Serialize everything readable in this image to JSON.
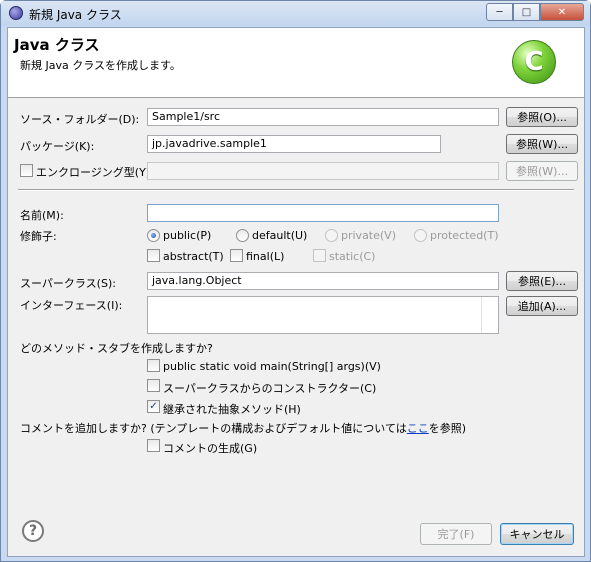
{
  "window": {
    "title": "新規 Java クラス",
    "minimize": "─",
    "maximize": "□",
    "close": "✕"
  },
  "banner": {
    "title": "Java クラス",
    "subtitle": "新規 Java クラスを作成します。",
    "icon_letter": "C"
  },
  "form": {
    "source_folder": {
      "label": "ソース・フォルダー(D):",
      "value": "Sample1/src",
      "button": "参照(O)..."
    },
    "package": {
      "label": "パッケージ(K):",
      "value": "jp.javadrive.sample1",
      "button": "参照(W)..."
    },
    "enclosing": {
      "label": "エンクロージング型(Y):",
      "value": "",
      "button": "参照(W)...",
      "checked": false
    },
    "name": {
      "label": "名前(M):",
      "value": ""
    },
    "modifiers": {
      "label": "修飾子:",
      "public": "public(P)",
      "default": "default(U)",
      "private": "private(V)",
      "protected": "protected(T)",
      "abstract": "abstract(T)",
      "final": "final(L)",
      "static": "static(C)"
    },
    "superclass": {
      "label": "スーパークラス(S):",
      "value": "java.lang.Object",
      "button": "参照(E)..."
    },
    "interfaces": {
      "label": "インターフェース(I):",
      "button": "追加(A)..."
    },
    "stubs": {
      "question": "どのメソッド・スタブを作成しますか?",
      "main": "public static void main(String[] args)(V)",
      "constructors": "スーパークラスからのコンストラクター(C)",
      "inherited": "継承された抽象メソッド(H)",
      "checkmark": "✓"
    },
    "comments": {
      "question_before": "コメントを追加しますか? (テンプレートの構成およびデフォルト値については",
      "question_link": "ここ",
      "question_after": "を参照)",
      "generate": "コメントの生成(G)"
    }
  },
  "footer": {
    "help": "?",
    "finish": "完了(F)",
    "cancel": "キャンセル"
  }
}
